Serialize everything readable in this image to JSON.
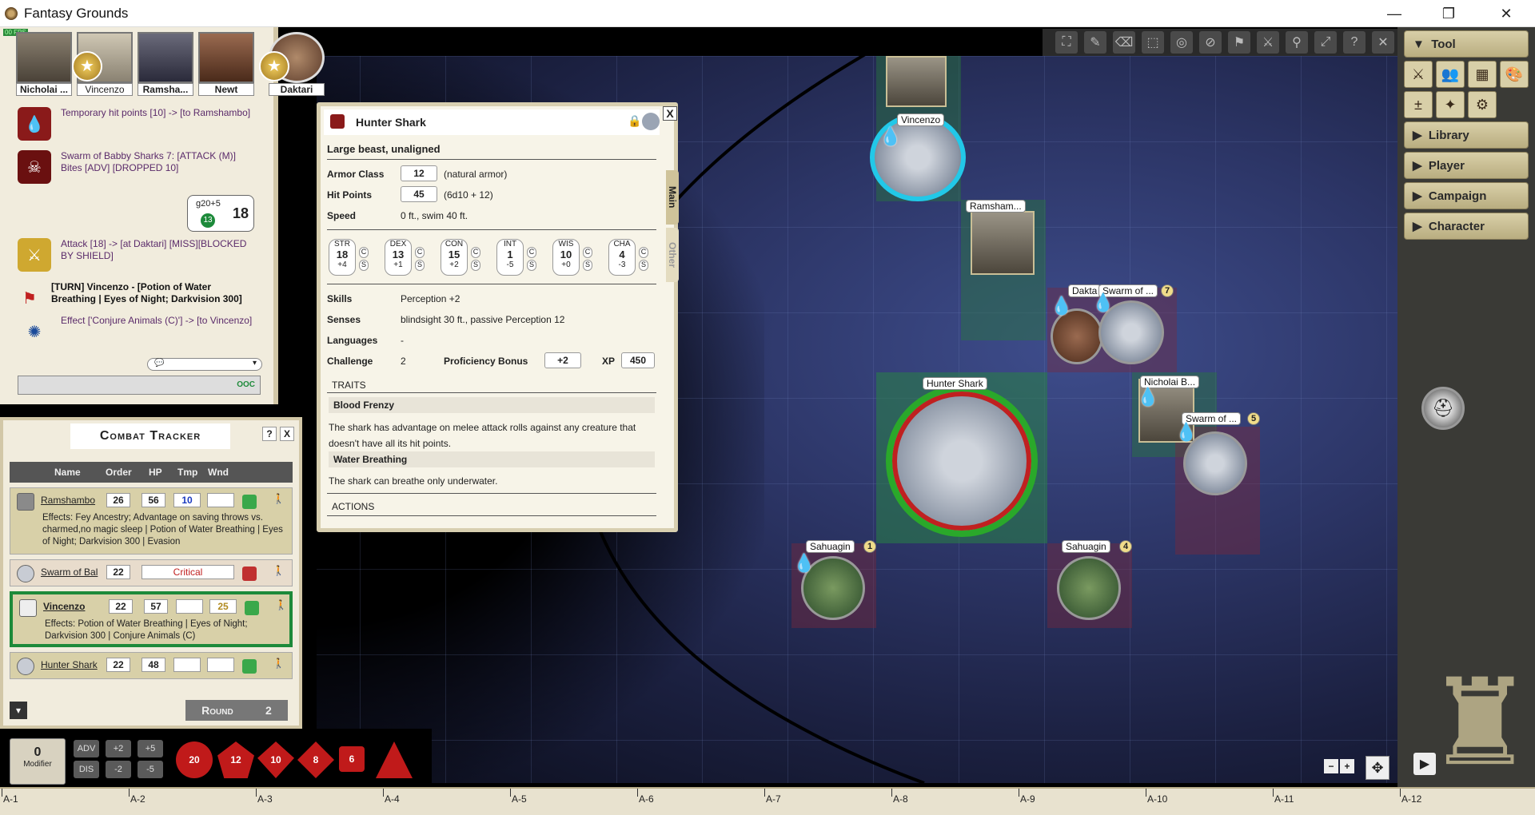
{
  "window": {
    "title": "Fantasy Grounds",
    "minimize": "—",
    "restore": "❐",
    "close": "✕"
  },
  "party": [
    {
      "name": "Nicholai ..."
    },
    {
      "name": "Vincenzo"
    },
    {
      "name": "Ramsha..."
    },
    {
      "name": "Newt"
    },
    {
      "name": "Daktari"
    }
  ],
  "chat": {
    "messages": [
      {
        "text": "Temporary hit points [10] -> [to Ramshambo]"
      },
      {
        "text": "Swarm of Babby Sharks 7: [ATTACK (M)] Bites [ADV] [DROPPED 10]"
      },
      {
        "text": "Attack [18] -> [at Daktari] [MISS][BLOCKED BY SHIELD]"
      },
      {
        "text": "[TURN] Vincenzo - [Potion of Water Breathing | Eyes of Night; Darkvision 300]"
      },
      {
        "text": "Effect ['Conjure Animals (C)'] -> [to Vincenzo]"
      }
    ],
    "dice": {
      "formula": "g20+5",
      "die": "13",
      "total": "18"
    },
    "ooc": "OOC"
  },
  "combat_tracker": {
    "title": "Combat Tracker",
    "help": "?",
    "close": "X",
    "columns": {
      "name": "Name",
      "order": "Order",
      "hp": "HP",
      "tmp": "Tmp",
      "wnd": "Wnd"
    },
    "rows": [
      {
        "name": "Ramshambo",
        "order": "26",
        "hp": "56",
        "tmp": "10",
        "wnd": "",
        "effects": "Effects: Fey Ancestry; Advantage on saving throws vs. charmed,no magic sleep | Potion of Water Breathing | Eyes of Night; Darkvision 300 | Evasion"
      },
      {
        "name": "Swarm of Bal",
        "order": "22",
        "status": "Critical"
      },
      {
        "name": "Vincenzo",
        "order": "22",
        "hp": "57",
        "tmp": "",
        "wnd": "25",
        "effects": "Effects: Potion of Water Breathing | Eyes of Night; Darkvision 300 | Conjure Animals (C)"
      },
      {
        "name": "Hunter Shark",
        "order": "22",
        "hp": "48",
        "tmp": "",
        "wnd": ""
      }
    ],
    "round_label": "Round",
    "round": "2"
  },
  "sheet": {
    "title": "Hunter Shark",
    "close": "X",
    "type": "Large beast, unaligned",
    "tabs": {
      "main": "Main",
      "other": "Other"
    },
    "ac_label": "Armor Class",
    "ac": "12",
    "ac_note": "(natural armor)",
    "hp_label": "Hit Points",
    "hp": "45",
    "hp_note": "(6d10 + 12)",
    "speed_label": "Speed",
    "speed": "0 ft., swim 40 ft.",
    "abilities": [
      {
        "name": "STR",
        "score": "18",
        "mod": "+4"
      },
      {
        "name": "DEX",
        "score": "13",
        "mod": "+1"
      },
      {
        "name": "CON",
        "score": "15",
        "mod": "+2"
      },
      {
        "name": "INT",
        "score": "1",
        "mod": "-5"
      },
      {
        "name": "WIS",
        "score": "10",
        "mod": "+0"
      },
      {
        "name": "CHA",
        "score": "4",
        "mod": "-3"
      }
    ],
    "c_label": "C",
    "s_label": "S",
    "skills_label": "Skills",
    "skills": "Perception +2",
    "senses_label": "Senses",
    "senses": "blindsight 30 ft., passive Perception 12",
    "languages_label": "Languages",
    "languages": "-",
    "challenge_label": "Challenge",
    "challenge": "2",
    "prof_label": "Proficiency Bonus",
    "prof": "+2",
    "xp_label": "XP",
    "xp": "450",
    "traits_header": "TRAITS",
    "trait1_name": "Blood Frenzy",
    "trait1_text": "The shark has advantage on melee attack rolls against any creature that doesn't have all its hit points.",
    "trait2_name": "Water Breathing",
    "trait2_text": "The shark can breathe only underwater.",
    "actions_header": "ACTIONS"
  },
  "modifier": {
    "value": "0",
    "label": "Modifier"
  },
  "adv_buttons": {
    "adv": "ADV",
    "dis": "DIS",
    "p2": "+2",
    "m2": "-2",
    "p5": "+5",
    "m5": "-5"
  },
  "dice": [
    {
      "label": "20"
    },
    {
      "label": "12"
    },
    {
      "label": "10"
    },
    {
      "label": "8"
    },
    {
      "label": "6"
    },
    {
      "label": ""
    }
  ],
  "sidebar": {
    "tool": "Tool",
    "library": "Library",
    "player": "Player",
    "campaign": "Campaign",
    "character": "Character"
  },
  "tokens": {
    "vincenzo": "Vincenzo",
    "ramsham": "Ramsham...",
    "dakta": "Dakta",
    "swarm1": "Swarm of ...",
    "swarm1_num": "7",
    "hunter": "Hunter Shark",
    "nicholai": "Nicholai B...",
    "swarm2": "Swarm of ...",
    "swarm2_num": "5",
    "sahuagin1": "Sahuagin",
    "sahuagin1_num": "1",
    "sahuagin2": "Sahuagin",
    "sahuagin2_num": "4"
  },
  "ruler": [
    "A-1",
    "A-2",
    "A-3",
    "A-4",
    "A-5",
    "A-6",
    "A-7",
    "A-8",
    "A-9",
    "A-10",
    "A-11",
    "A-12"
  ],
  "fps_badge": "00 FPS",
  "colors": {
    "accent_green": "#1d8a3a",
    "blood": "#b41a1a",
    "parchment": "#f1ecdd"
  }
}
